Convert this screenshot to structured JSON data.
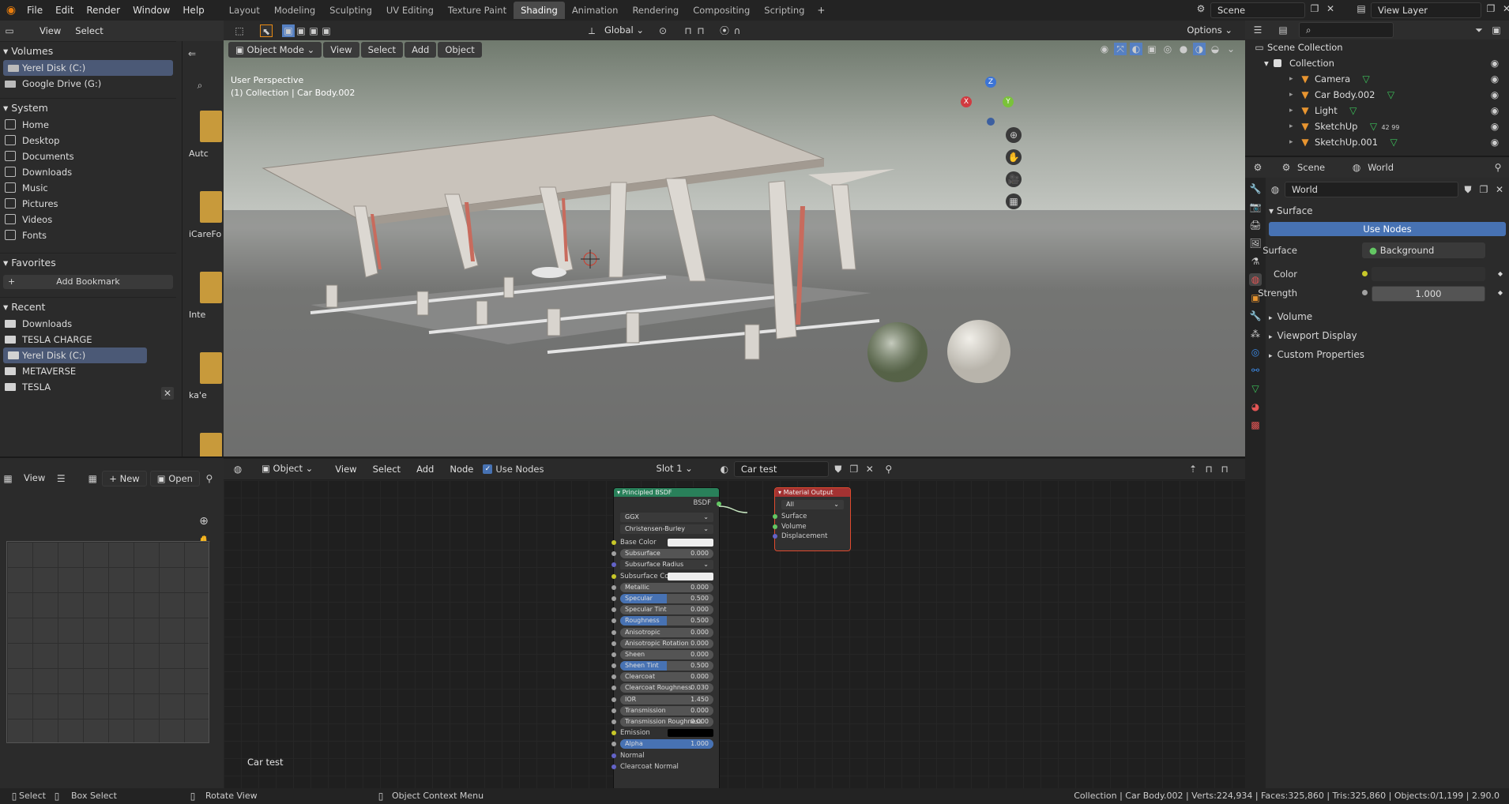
{
  "menu": {
    "file": "File",
    "edit": "Edit",
    "render": "Render",
    "window": "Window",
    "help": "Help"
  },
  "workspaces": [
    "Layout",
    "Modeling",
    "Sculpting",
    "UV Editing",
    "Texture Paint",
    "Shading",
    "Animation",
    "Rendering",
    "Compositing",
    "Scripting"
  ],
  "active_workspace": "Shading",
  "scene_field": "Scene",
  "view_layer_field": "View Layer",
  "filebrowser": {
    "header": {
      "view": "View",
      "select": "Select"
    },
    "volumes_title": "Volumes",
    "volumes": [
      "Yerel Disk (C:)",
      "Google Drive (G:)"
    ],
    "system_title": "System",
    "system": [
      "Home",
      "Desktop",
      "Documents",
      "Downloads",
      "Music",
      "Pictures",
      "Videos",
      "Fonts"
    ],
    "favorites_title": "Favorites",
    "add_bookmark": "Add Bookmark",
    "recent_title": "Recent",
    "recent": [
      "Downloads",
      "TESLA CHARGE",
      "Yerel Disk (C:)",
      "METAVERSE",
      "TESLA"
    ],
    "folder_labels": [
      "Autc",
      "iCareFo",
      "Inte",
      "ka'e",
      ""
    ]
  },
  "viewport": {
    "mode": "Object Mode",
    "view": "View",
    "select": "Select",
    "add": "Add",
    "object": "Object",
    "transform": "Global",
    "options": "Options",
    "perspective": "User Perspective",
    "collection_label": "(1) Collection | Car Body.002",
    "axis": {
      "x": "X",
      "y": "Y",
      "z": "Z"
    }
  },
  "outliner": {
    "scene_collection": "Scene Collection",
    "collection": "Collection",
    "items": [
      {
        "name": "Camera"
      },
      {
        "name": "Car Body.002"
      },
      {
        "name": "Light"
      },
      {
        "name": "SketchUp",
        "extra": "42  99"
      },
      {
        "name": "SketchUp.001"
      }
    ]
  },
  "properties": {
    "scene_tab": "Scene",
    "world_tab": "World",
    "world_name": "World",
    "surface_panel": "Surface",
    "use_nodes": "Use Nodes",
    "surface_label": "Surface",
    "surface_value": "Background",
    "color_label": "Color",
    "strength_label": "Strength",
    "strength_value": "1.000",
    "panels": [
      "Volume",
      "Viewport Display",
      "Custom Properties"
    ]
  },
  "image_editor": {
    "view": "View",
    "new": "New",
    "open": "Open"
  },
  "node_editor": {
    "object": "Object",
    "view": "View",
    "select": "Select",
    "add": "Add",
    "node": "Node",
    "use_nodes": "Use Nodes",
    "slot": "Slot 1",
    "material": "Car test",
    "footer_label": "Car test",
    "bsdf_title": "Principled BSDF",
    "bsdf_out": "BSDF",
    "dist": "GGX",
    "sss_method": "Christensen-Burley",
    "rows": [
      {
        "label": "Base Color",
        "type": "color",
        "swatch": "#eeeeee",
        "sock": "y"
      },
      {
        "label": "Subsurface",
        "value": "0.000",
        "type": "num",
        "sock": "g"
      },
      {
        "label": "Subsurface Radius",
        "type": "drop",
        "sock": "b"
      },
      {
        "label": "Subsurface Color",
        "type": "color",
        "swatch": "#eeeeee",
        "sock": "y"
      },
      {
        "label": "Metallic",
        "value": "0.000",
        "type": "num",
        "sock": "g"
      },
      {
        "label": "Specular",
        "value": "0.500",
        "type": "num",
        "fill": 0.5,
        "sock": "g"
      },
      {
        "label": "Specular Tint",
        "value": "0.000",
        "type": "num",
        "sock": "g"
      },
      {
        "label": "Roughness",
        "value": "0.500",
        "type": "num",
        "fill": 0.5,
        "sock": "g"
      },
      {
        "label": "Anisotropic",
        "value": "0.000",
        "type": "num",
        "sock": "g"
      },
      {
        "label": "Anisotropic Rotation",
        "value": "0.000",
        "type": "num",
        "sock": "g"
      },
      {
        "label": "Sheen",
        "value": "0.000",
        "type": "num",
        "sock": "g"
      },
      {
        "label": "Sheen Tint",
        "value": "0.500",
        "type": "num",
        "fill": 0.5,
        "sock": "g"
      },
      {
        "label": "Clearcoat",
        "value": "0.000",
        "type": "num",
        "sock": "g"
      },
      {
        "label": "Clearcoat Roughness",
        "value": "0.030",
        "type": "num",
        "sock": "g"
      },
      {
        "label": "IOR",
        "value": "1.450",
        "type": "num",
        "sock": "g"
      },
      {
        "label": "Transmission",
        "value": "0.000",
        "type": "num",
        "sock": "g"
      },
      {
        "label": "Transmission Roughness",
        "value": "0.000",
        "type": "num",
        "sock": "g"
      },
      {
        "label": "Emission",
        "type": "color",
        "swatch": "#000000",
        "sock": "y"
      },
      {
        "label": "Alpha",
        "value": "1.000",
        "type": "num",
        "fill": 1.0,
        "sock": "g"
      },
      {
        "label": "Normal",
        "type": "plain",
        "sock": "b"
      },
      {
        "label": "Clearcoat Normal",
        "type": "plain",
        "sock": "b"
      }
    ],
    "out_title": "Material Output",
    "out_target": "All",
    "out_rows": [
      "Surface",
      "Volume",
      "Displacement"
    ]
  },
  "statusbar": {
    "select": "Select",
    "box_select": "Box Select",
    "rotate": "Rotate View",
    "context": "Object Context Menu",
    "stats": "Collection | Car Body.002 | Verts:224,934 | Faces:325,860 | Tris:325,860 | Objects:0/1,199 | 2.90.0"
  },
  "colors": {
    "accent": "#4772b3",
    "header_bsdf": "#29805a",
    "header_output": "#a33232",
    "selected": "#5680c2"
  }
}
